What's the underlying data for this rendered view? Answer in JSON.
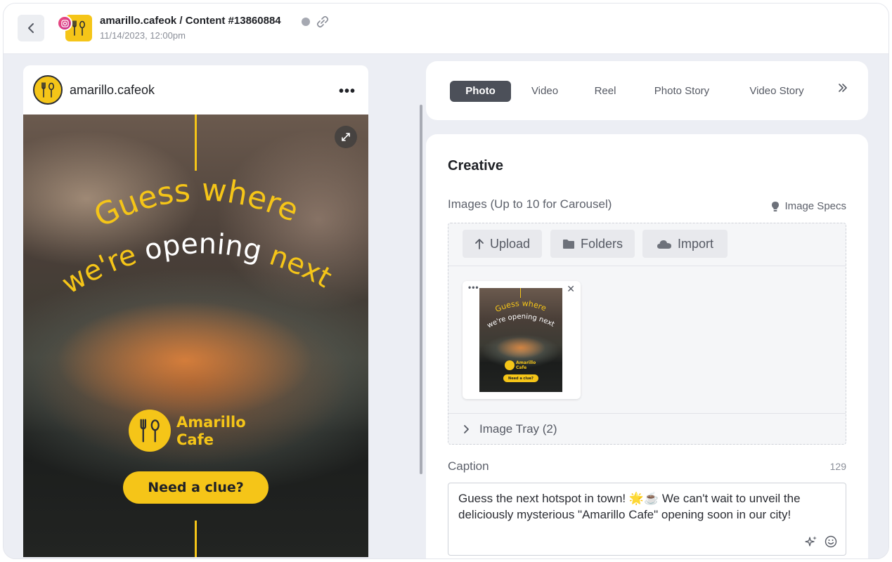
{
  "header": {
    "title": "amarillo.cafeok / Content #13860884",
    "timestamp": "11/14/2023, 12:00pm"
  },
  "post": {
    "account_name": "amarillo.cafeok",
    "headline_line1": "Guess where",
    "headline_line2a": "we're",
    "headline_line2b": "opening",
    "headline_line2c": "next",
    "brand_line1": "Amarillo",
    "brand_line2": "Cafe",
    "cta": "Need a clue?"
  },
  "type_tabs": {
    "items": [
      {
        "label": "Photo",
        "active": true
      },
      {
        "label": "Video",
        "active": false
      },
      {
        "label": "Reel",
        "active": false
      },
      {
        "label": "Photo Story",
        "active": false
      },
      {
        "label": "Video Story",
        "active": false
      }
    ]
  },
  "creative": {
    "title": "Creative",
    "images_label": "Images (Up to 10 for Carousel)",
    "image_specs": "Image Specs",
    "upload": "Upload",
    "folders": "Folders",
    "import": "Import",
    "image_tray": "Image Tray (2)",
    "caption_label": "Caption",
    "caption_count": "129",
    "caption_text": "Guess the next hotspot in town! 🌟☕ We can't wait to unveil the deliciously mysterious \"Amarillo Cafe\" opening soon in our city!",
    "thumb": {
      "headline_line1": "Guess where",
      "headline_line2": "we're opening next",
      "brand_line1": "Amarillo",
      "brand_line2": "Cafe",
      "cta": "Need a clue?"
    }
  },
  "colors": {
    "brand_yellow": "#f5c518",
    "active_tab": "#4c5059",
    "instagram": "#e4405f"
  }
}
